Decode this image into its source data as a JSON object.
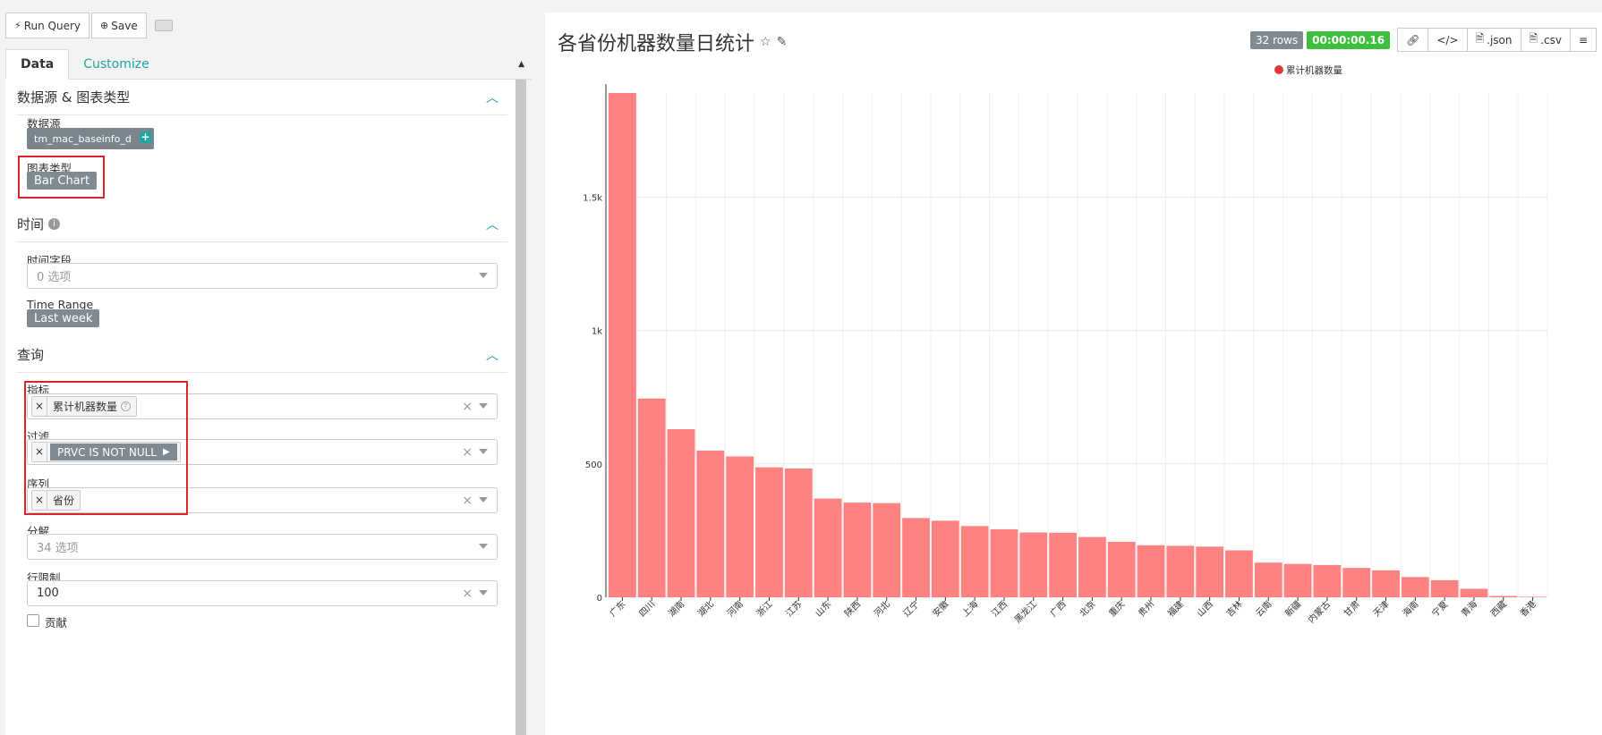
{
  "toolbar": {
    "run_query": "Run Query",
    "save": "Save"
  },
  "tabs": [
    {
      "label": "Data"
    },
    {
      "label": "Customize"
    }
  ],
  "sections": {
    "datasource": {
      "title": "数据源 & 图表类型",
      "datasource_label": "数据源",
      "datasource_value": "tm_mac_baseinfo_d",
      "viz_label": "图表类型",
      "viz_value": "Bar Chart"
    },
    "time": {
      "title": "时间",
      "time_column_label": "时间字段",
      "time_column_placeholder": "0 选项",
      "time_range_label": "Time Range",
      "time_range_value": "Last week"
    },
    "query": {
      "title": "查询",
      "metrics_label": "指标",
      "metrics_value": "累计机器数量",
      "filters_label": "过滤",
      "filters_value": "PRVC IS NOT NULL",
      "series_label": "序列",
      "series_value": "省份",
      "breakdowns_label": "分解",
      "breakdowns_placeholder": "34 选项",
      "row_limit_label": "行限制",
      "row_limit_value": "100",
      "contribution_label": "贡献"
    }
  },
  "chart_header": {
    "title": "各省份机器数量日统计",
    "rows": "32 rows",
    "duration": "00:00:00.16",
    "json": ".json",
    "csv": ".csv"
  },
  "chart_data": {
    "type": "bar",
    "categories": [
      "广东",
      "四川",
      "湖南",
      "湖北",
      "河南",
      "浙江",
      "江苏",
      "山东",
      "陕西",
      "河北",
      "辽宁",
      "安徽",
      "上海",
      "江西",
      "黑龙江",
      "广西",
      "北京",
      "重庆",
      "贵州",
      "福建",
      "山西",
      "吉林",
      "云南",
      "新疆",
      "内蒙古",
      "甘肃",
      "天津",
      "海南",
      "宁夏",
      "青海",
      "西藏",
      "香港"
    ],
    "series": [
      {
        "name": "累计机器数量",
        "values": [
          1890,
          745,
          630,
          550,
          528,
          487,
          483,
          370,
          355,
          353,
          297,
          287,
          267,
          255,
          243,
          242,
          226,
          208,
          195,
          193,
          190,
          176,
          130,
          125,
          121,
          110,
          101,
          76,
          64,
          32,
          5,
          2
        ]
      }
    ],
    "ylim": [
      0,
      1890
    ],
    "yticks": [
      "0",
      "500",
      "1k",
      "1.5k"
    ],
    "ytick_values": [
      0,
      500,
      1000,
      1500
    ],
    "legend": "top-right",
    "bar_color": "#ff8282",
    "grid": true
  }
}
